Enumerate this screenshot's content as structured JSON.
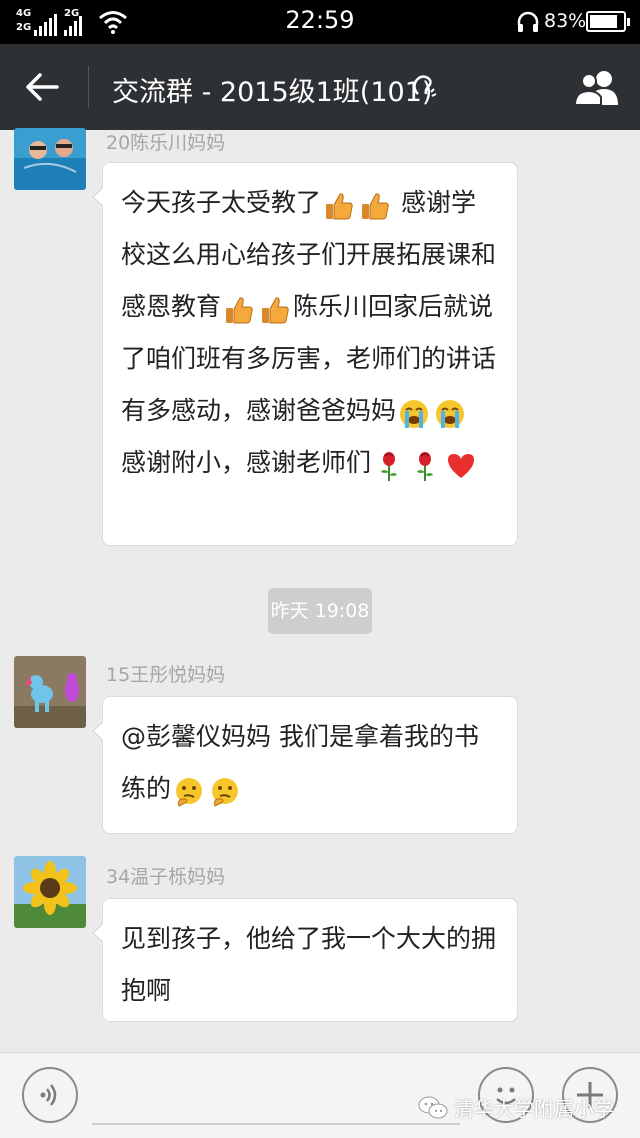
{
  "status_bar": {
    "network_1": "4G",
    "network_2": "2G",
    "network_3": "2G",
    "time": "22:59",
    "battery_percent": "83%",
    "battery_level": 0.83
  },
  "header": {
    "title": "交流群 - 2015级1班(101)",
    "back_icon": "arrow-left-icon",
    "earpiece_icon": "earpiece-icon",
    "members_icon": "group-members-icon"
  },
  "messages": [
    {
      "sender": "20陈乐川妈妈",
      "avatar": "swimming-kids-avatar",
      "segments": [
        {
          "t": "text",
          "v": "今天孩子太受教了"
        },
        {
          "t": "emoji",
          "v": "thumbs-up"
        },
        {
          "t": "emoji",
          "v": "thumbs-up"
        },
        {
          "t": "text",
          "v": " 感谢学校这么用心给孩子们开展拓展课和感恩教育"
        },
        {
          "t": "emoji",
          "v": "thumbs-up"
        },
        {
          "t": "emoji",
          "v": "thumbs-up"
        },
        {
          "t": "text",
          "v": "陈乐川回家后就说了咱们班有多厉害，老师们的讲话有多感动，感谢爸爸妈妈"
        },
        {
          "t": "emoji",
          "v": "crying-face"
        },
        {
          "t": "emoji",
          "v": "crying-face"
        },
        {
          "t": "text",
          "v": " 感谢附小，感谢老师们"
        },
        {
          "t": "emoji",
          "v": "rose"
        },
        {
          "t": "emoji",
          "v": "rose"
        },
        {
          "t": "emoji",
          "v": "heart"
        }
      ]
    },
    {
      "sender": "15王彤悦妈妈",
      "avatar": "toy-pony-avatar",
      "segments": [
        {
          "t": "text",
          "v": "@彭馨仪妈妈 我们是拿着我的书练的"
        },
        {
          "t": "emoji",
          "v": "thinking-face"
        },
        {
          "t": "emoji",
          "v": "thinking-face"
        }
      ]
    },
    {
      "sender": "34温子栎妈妈",
      "avatar": "sunflower-avatar",
      "segments": [
        {
          "t": "text",
          "v": "见到孩子，他给了我一个大大的拥抱啊"
        }
      ]
    }
  ],
  "timestamp": "昨天 19:08",
  "bottom_bar": {
    "voice_icon": "voice-icon",
    "emoji_icon": "smiley-icon",
    "add_icon": "plus-icon",
    "watermark": "清华大学附属小学"
  },
  "colors": {
    "nav_bg": "#2e3134",
    "chat_bg": "#ebebeb",
    "bubble_bg": "#ffffff",
    "timestamp_bg": "#cecece"
  }
}
